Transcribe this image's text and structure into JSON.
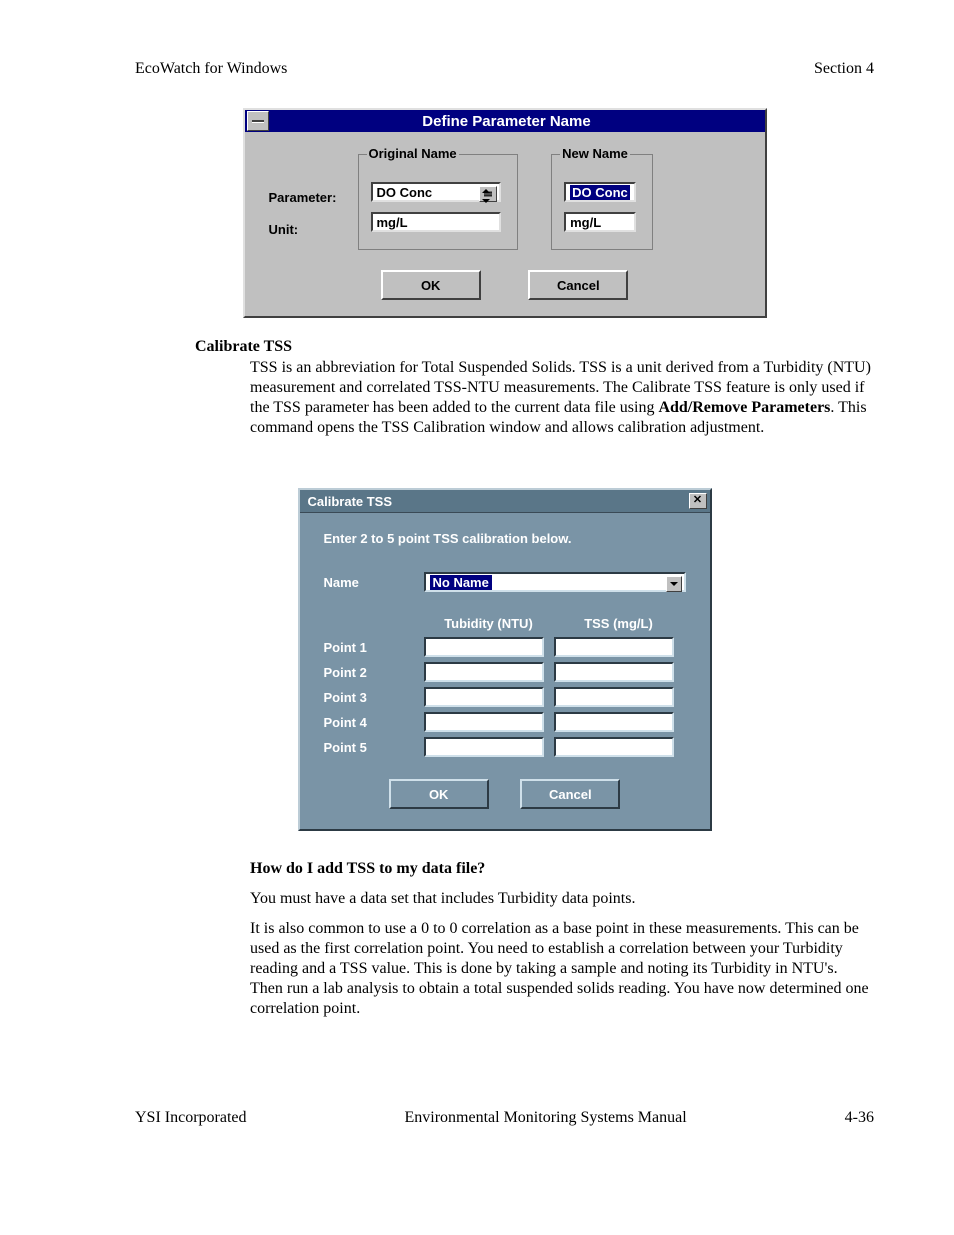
{
  "header": {
    "left": "EcoWatch for Windows",
    "right": "Section 4"
  },
  "dialog1": {
    "title": "Define Parameter Name",
    "row_labels": {
      "parameter": "Parameter:",
      "unit": "Unit:"
    },
    "original": {
      "legend": "Original Name",
      "parameter_value": "DO Conc",
      "unit_value": "mg/L"
    },
    "newname": {
      "legend": "New Name",
      "parameter_value": "DO Conc",
      "unit_value": "mg/L"
    },
    "ok": "OK",
    "cancel": "Cancel"
  },
  "section1": {
    "heading": "Calibrate TSS",
    "para_a": "TSS is an abbreviation for Total Suspended Solids.  TSS is a unit derived from a Turbidity (NTU) measurement and correlated TSS-NTU measurements. The Calibrate TSS feature is only used if the TSS parameter has been added to the current data file using ",
    "bold": "Add/Remove Parameters",
    "para_b": ".  This command opens the TSS Calibration window and allows calibration adjustment."
  },
  "dialog2": {
    "title": "Calibrate TSS",
    "instruction": "Enter 2 to 5 point TSS calibration below.",
    "name_label": "Name",
    "name_value": "No Name",
    "col_turbidity": "Tubidity (NTU)",
    "col_tss": "TSS (mg/L)",
    "points": [
      "Point 1",
      "Point 2",
      "Point 3",
      "Point 4",
      "Point 5"
    ],
    "ok": "OK",
    "cancel": "Cancel"
  },
  "section2": {
    "heading": "How do I add TSS to my data file?",
    "p1": "You must have a data set that includes Turbidity data points.",
    "p2": "It is also common to use a 0 to 0 correlation as a base point in these measurements.  This can be used as the first correlation point. You need to establish a correlation between your Turbidity reading and a TSS value.  This is done by taking a sample and noting its Turbidity in NTU's.  Then run a lab analysis to obtain a total suspended solids reading.  You have now determined one correlation point."
  },
  "footer": {
    "left": "YSI Incorporated",
    "center": "Environmental Monitoring Systems Manual",
    "right": "4-36"
  }
}
